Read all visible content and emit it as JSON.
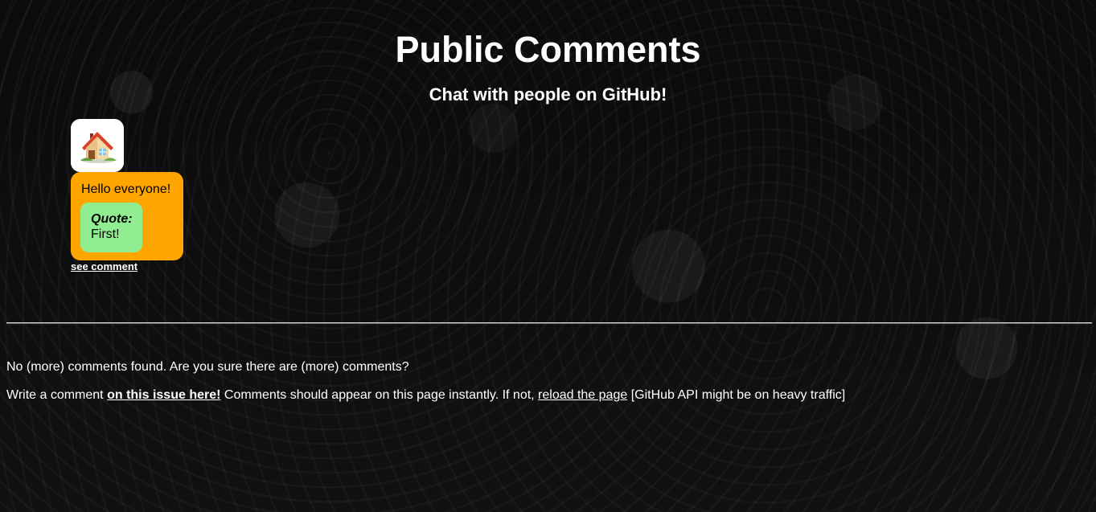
{
  "page": {
    "title": "Public Comments",
    "subtitle": "Chat with people on GitHub!"
  },
  "comment": {
    "avatar_icon": "house-icon",
    "text": "Hello everyone!",
    "quote_label": "Quote:",
    "quote_text": "First!",
    "see_comment_label": "see comment"
  },
  "footer": {
    "empty_message": "No (more) comments found. Are you sure there are (more) comments?",
    "write_prefix": "Write a comment ",
    "issue_link_label": "on this issue here!",
    "instant_text": " Comments should appear on this page instantly. If not, ",
    "reload_link_label": "reload the page",
    "traffic_text": " [GitHub API might be on heavy traffic]"
  },
  "colors": {
    "background": "#0b0b0b",
    "bubble": "#ffa500",
    "quote": "#90ee90",
    "text": "#ffffff"
  }
}
